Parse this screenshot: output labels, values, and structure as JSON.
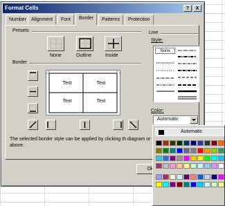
{
  "dialog": {
    "title": "Format Cells",
    "title_buttons": [
      "?",
      "X"
    ],
    "tabs": [
      "Number",
      "Alignment",
      "Font",
      "Border",
      "Patterns",
      "Protection"
    ],
    "active_tab": "Border"
  },
  "presets": {
    "label": "Presets",
    "none": "None",
    "outline": "Outline",
    "inside": "Inside"
  },
  "border": {
    "label": "Border",
    "preview_cells": [
      "Text",
      "Text",
      "Text",
      "Text"
    ],
    "hint": "The selected border style can be applied by clicking th diagram or the buttons above."
  },
  "line": {
    "label": "Line",
    "style_label": "Style:",
    "none_option": "None",
    "color_label": "Color:",
    "color_value": "Automatic"
  },
  "ok_button": "Ok",
  "color_popup": {
    "automatic_label": "Automatic",
    "rows": [
      [
        "#000000",
        "#993300",
        "#333300",
        "#003300",
        "#003366",
        "#000080",
        "#333399",
        "#333333",
        "#800000",
        "#ff6600"
      ],
      [
        "#808000",
        "#008000",
        "#008080",
        "#0000ff",
        "#666699",
        "#808080",
        "#ff0000",
        "#ff9900",
        "#99cc00",
        "#339966"
      ],
      [
        "#33cccc",
        "#3366ff",
        "#800080",
        "#969696",
        "#ff00ff",
        "#ffcc00",
        "#ffff00",
        "#00ff00",
        "#00ffff",
        "#00ccff"
      ],
      [
        "#993366",
        "#c0c0c0",
        "#ff99cc",
        "#ffcc99",
        "#ffff99",
        "#ccffcc",
        "#ccffff",
        "#99ccff",
        "#cc99ff",
        "#ffffff"
      ],
      [
        "#9999ff",
        "#993366",
        "#ffffcc",
        "#ccffff",
        "#660066",
        "#ff8080",
        "#0066cc",
        "#ccccff",
        "#000080",
        "#ff00ff"
      ],
      [
        "#ffff00",
        "#00ffff",
        "#800080",
        "#800000",
        "#008080",
        "#0000ff",
        "#00ccff",
        "#ccffff",
        "#ccffcc",
        "#ffff99"
      ]
    ]
  }
}
